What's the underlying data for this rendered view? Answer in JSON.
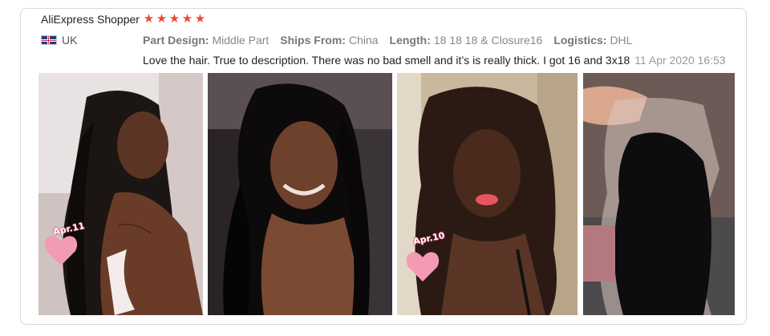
{
  "review": {
    "reviewer": "AliExpress Shopper",
    "rating": 5,
    "stars": [
      "★",
      "★",
      "★",
      "★",
      "★"
    ],
    "country_flag": "uk-flag-icon",
    "country": "UK",
    "specs": [
      {
        "label": "Part Design:",
        "value": "Middle Part"
      },
      {
        "label": "Ships From:",
        "value": "China"
      },
      {
        "label": "Length:",
        "value": "18 18 18 & Closure16"
      },
      {
        "label": "Logistics:",
        "value": "DHL"
      }
    ],
    "text": "Love the hair. True to description. There was no bad smell and it’s is really thick. I got 16 and 3x18",
    "date": "11 Apr 2020 16:53"
  },
  "photos": {
    "stickers": [
      "Apr.11",
      "Apr.10"
    ]
  },
  "colors": {
    "star": "#f0473b",
    "border": "#d9d9d9",
    "muted_text": "#888888"
  }
}
